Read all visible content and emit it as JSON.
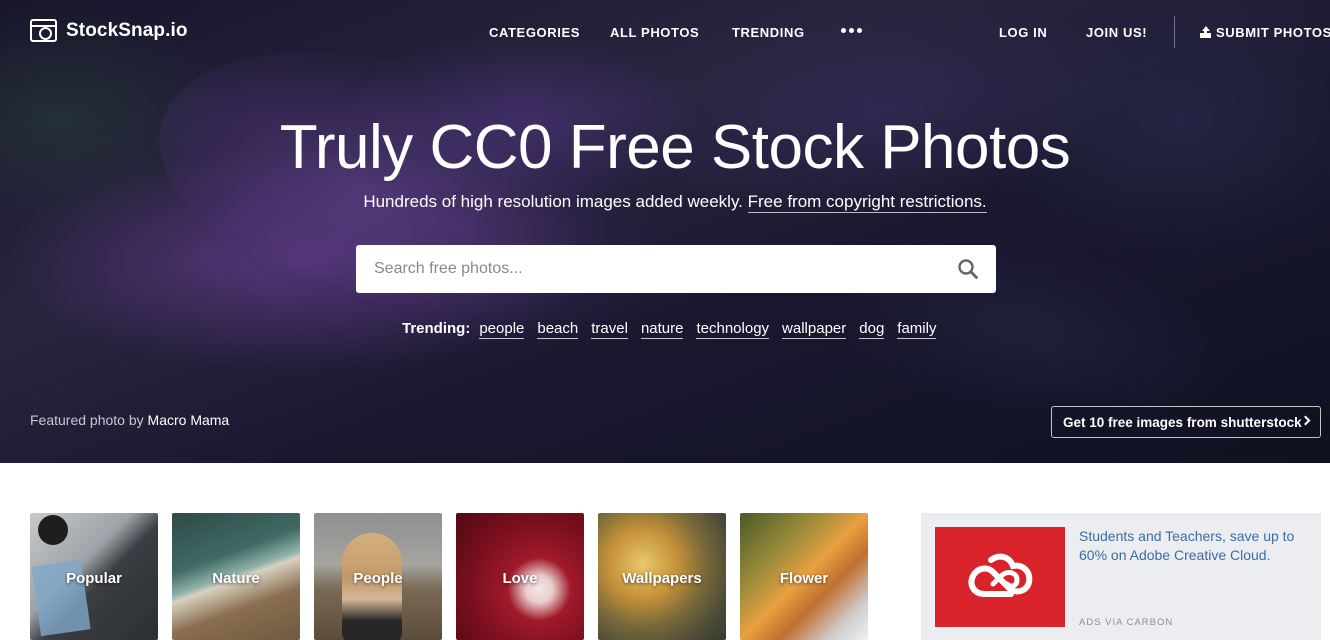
{
  "brand": {
    "name": "StockSnap.io"
  },
  "nav": {
    "categories": "CATEGORIES",
    "all_photos": "ALL PHOTOS",
    "trending": "TRENDING",
    "log_in": "LOG IN",
    "join": "JOIN US!",
    "submit": "SUBMIT PHOTOS"
  },
  "hero": {
    "title": "Truly CC0 Free Stock Photos",
    "subtitle": "Hundreds of high resolution images added weekly.",
    "subtitle_link": "Free from copyright restrictions."
  },
  "search": {
    "placeholder": "Search free photos..."
  },
  "trending": {
    "label": "Trending:",
    "tags": [
      "people",
      "beach",
      "travel",
      "nature",
      "technology",
      "wallpaper",
      "dog",
      "family"
    ]
  },
  "featured": {
    "prefix": "Featured photo by",
    "author": "Macro Mama"
  },
  "promo_button": "Get 10 free images from shutterstock",
  "categories": [
    {
      "label": "Popular"
    },
    {
      "label": "Nature"
    },
    {
      "label": "People"
    },
    {
      "label": "Love"
    },
    {
      "label": "Wallpapers"
    },
    {
      "label": "Flower"
    }
  ],
  "ad": {
    "text": "Students and Teachers, save up to 60% on Adobe Creative Cloud.",
    "via": "ADS VIA CARBON",
    "color": "#d9232a"
  },
  "colors": {
    "accent_link": "#3b6ea5",
    "white": "#ffffff"
  }
}
